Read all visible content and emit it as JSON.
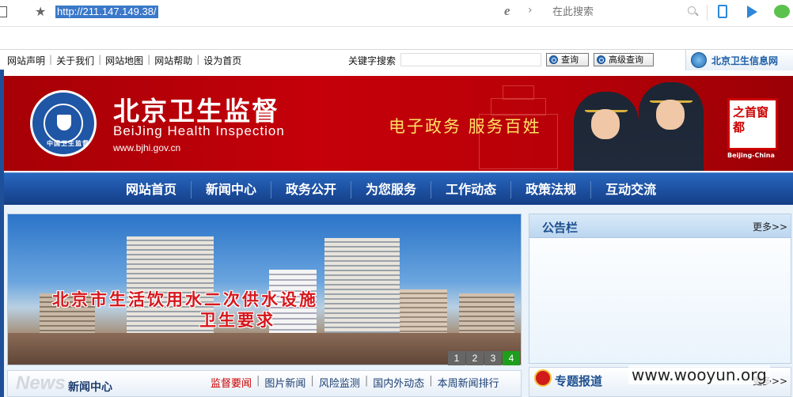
{
  "browser": {
    "url": "http://211.147.149.38/",
    "search_placeholder": "在此搜索"
  },
  "top_bar": {
    "links": [
      "网站声明",
      "关于我们",
      "网站地图",
      "网站帮助",
      "设为首页"
    ],
    "keyword_label": "关键字搜索",
    "query_button": "查询",
    "advanced_button": "高级查询",
    "network_label": "北京卫生信息网"
  },
  "header": {
    "title": "北京卫生监督",
    "subtitle": "BeiJing Health Inspection",
    "url": "www.bjhi.gov.cn",
    "slogan": "电子政务  服务百姓",
    "stamp_text": "之首窗都",
    "stamp_sub": "Beijing-China",
    "emblem_text": "中国卫生监督"
  },
  "nav": {
    "items": [
      "网站首页",
      "新闻中心",
      "政务公开",
      "为您服务",
      "工作动态",
      "政策法规",
      "互动交流"
    ]
  },
  "slideshow": {
    "caption_line1": "北京市生活饮用水二次供水设施",
    "caption_line2": "卫生要求",
    "pages": [
      "1",
      "2",
      "3",
      "4"
    ],
    "active_page": "4"
  },
  "notice": {
    "title": "公告栏",
    "more": "更多>>"
  },
  "news": {
    "ghost": "News",
    "title": "新闻中心",
    "tabs": [
      "监督要闻",
      "图片新闻",
      "风险监测",
      "国内外动态",
      "本周新闻排行"
    ]
  },
  "special": {
    "title": "专题报道",
    "more": "更多>>"
  },
  "watermark": "www.wooyun.org",
  "colors": {
    "banner_red": "#c5000a",
    "nav_blue": "#1c4fa0",
    "slogan_yellow": "#ffe066",
    "active_page_green": "#1e9e1e"
  }
}
